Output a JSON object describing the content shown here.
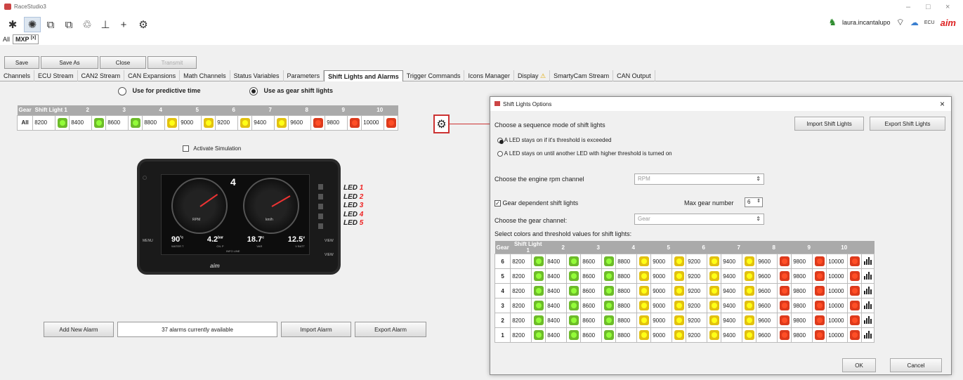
{
  "app": {
    "title": "RaceStudio3",
    "window_controls": [
      "–",
      "□",
      "×"
    ]
  },
  "toolbar": {
    "icons": [
      "wrench-icon",
      "gauge-device-icon",
      "config-icon",
      "config2-icon",
      "analysis-icon",
      "download-icon",
      "add-icon",
      "settings-icon"
    ]
  },
  "user": {
    "name": "laura.incantalupo",
    "ecu": "ECU",
    "brand": "aim"
  },
  "device_tabs": {
    "all": "All",
    "current": "MXP",
    "close": "[x]"
  },
  "buttons": {
    "save": "Save",
    "save_as": "Save As",
    "close": "Close",
    "transmit": "Transmit"
  },
  "tabs": [
    "Channels",
    "ECU Stream",
    "CAN2 Stream",
    "CAN Expansions",
    "Math Channels",
    "Status Variables",
    "Parameters",
    "Shift Lights and Alarms",
    "Trigger Commands",
    "Icons Manager",
    "Display",
    "SmartyCam Stream",
    "CAN Output"
  ],
  "active_tab": "Shift Lights and Alarms",
  "mode": {
    "predictive": "Use for predictive time",
    "gear": "Use as gear shift lights",
    "selected": "gear"
  },
  "main_table": {
    "headers": [
      "Gear",
      "Shift Light 1",
      "2",
      "3",
      "4",
      "5",
      "6",
      "7",
      "8",
      "9",
      "10"
    ],
    "gear": "All",
    "values": [
      "8200",
      "8400",
      "8600",
      "8800",
      "9000",
      "9200",
      "9400",
      "9600",
      "9800",
      "10000"
    ],
    "colors": [
      "#6dbb2a",
      "#6dbb2a",
      "#6dbb2a",
      "#e2c110",
      "#e2c110",
      "#e2c110",
      "#e2c110",
      "#dd3a1c",
      "#dd3a1c",
      "#dd3a1c"
    ]
  },
  "simulation": {
    "label": "Activate Simulation"
  },
  "display": {
    "gear": "4",
    "values": [
      "90",
      "4.2",
      "18.7",
      "12.5"
    ],
    "units": [
      "°c",
      "bar",
      "c",
      "v"
    ],
    "captions": [
      "WATER T",
      "OIL P",
      "VAR",
      "V BATT"
    ],
    "info": "INFO LINE",
    "rpm": "RPM",
    "kmh": "km/h",
    "left": "MENU",
    "right_top": "VIEW",
    "right_bottom": "VIEW"
  },
  "led_labels": [
    "LED",
    "LED",
    "LED",
    "LED",
    "LED"
  ],
  "led_numbers": [
    "1",
    "2",
    "3",
    "4",
    "5"
  ],
  "alarms": {
    "add": "Add New Alarm",
    "count": "37 alarms currently available",
    "import": "Import Alarm",
    "export": "Export Alarm"
  },
  "dialog": {
    "title": "Shift Lights Options",
    "sequence_label": "Choose a sequence mode of shift lights",
    "import": "Import Shift Lights",
    "export": "Export Shift Lights",
    "option1": "A LED stays on if it's threshold is exceeded",
    "option2": "A LED stays on until another LED with higher threshold is turned on",
    "rpm_label": "Choose the engine rpm channel",
    "rpm_value": "RPM",
    "gear_dep": "Gear dependent shift lights",
    "max_gear_label": "Max gear number",
    "max_gear": "6",
    "gear_channel_label": "Choose the gear channel:",
    "gear_channel": "Gear",
    "select_label": "Select colors and threshold values for shift lights:",
    "headers": [
      "Gear",
      "Shift Light 1",
      "2",
      "3",
      "4",
      "5",
      "6",
      "7",
      "8",
      "9",
      "10"
    ],
    "gears": [
      "6",
      "5",
      "4",
      "3",
      "2",
      "1"
    ],
    "values": [
      "8200",
      "8400",
      "8600",
      "8800",
      "9000",
      "9200",
      "9400",
      "9600",
      "9800",
      "10000"
    ],
    "colors": [
      "#6dbb2a",
      "#6dbb2a",
      "#6dbb2a",
      "#e2c110",
      "#e2c110",
      "#e2c110",
      "#e2c110",
      "#dd3a1c",
      "#dd3a1c",
      "#dd3a1c"
    ],
    "ok": "OK",
    "cancel": "Cancel"
  }
}
